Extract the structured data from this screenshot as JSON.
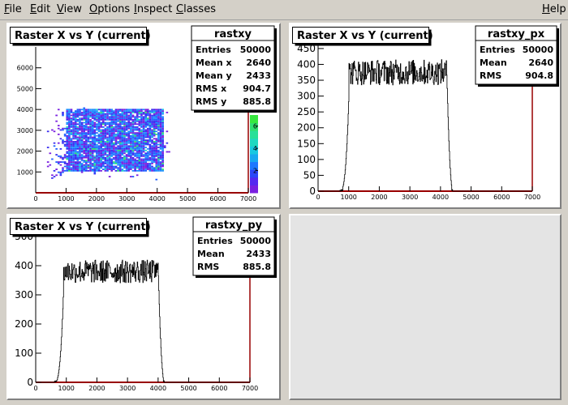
{
  "menu": {
    "file": {
      "ul": "F",
      "rest": "ile"
    },
    "edit": {
      "ul": "E",
      "rest": "dit"
    },
    "view": {
      "ul": "V",
      "rest": "iew"
    },
    "options": {
      "ul": "O",
      "rest": "ptions"
    },
    "inspect": {
      "ul": "I",
      "rest": "nspect"
    },
    "classes": {
      "ul": "C",
      "rest": "lasses"
    },
    "help": {
      "ul": "H",
      "rest": "elp"
    }
  },
  "colors": {
    "axis": "#000000",
    "frame_red": "#990000",
    "stats_fill": "#ffffff"
  },
  "chart_data": [
    {
      "type": "heatmap",
      "title": "Raster X vs Y (current)",
      "xlim": [
        0,
        7000
      ],
      "ylim": [
        0,
        7000
      ],
      "x_ticks": [
        0,
        1000,
        2000,
        3000,
        4000,
        5000,
        6000,
        7000
      ],
      "y_ticks": [
        1000,
        2000,
        3000,
        4000,
        5000,
        6000
      ],
      "z_ticks": [
        2,
        4,
        6
      ],
      "zlim": [
        0,
        7
      ],
      "region": {
        "x": [
          1000,
          4200
        ],
        "y": [
          1000,
          4000
        ]
      },
      "stats": {
        "name": "rastxy",
        "rows": [
          {
            "label": "Entries",
            "value": "50000"
          },
          {
            "label": "Mean x",
            "value": "2640"
          },
          {
            "label": "Mean y",
            "value": "2433"
          },
          {
            "label": "RMS x",
            "value": "904.7"
          },
          {
            "label": "RMS y",
            "value": "885.8"
          }
        ]
      }
    },
    {
      "type": "line",
      "title": "Raster X vs Y (current)",
      "xlim": [
        0,
        7000
      ],
      "ylim": [
        0,
        460
      ],
      "x_ticks": [
        0,
        1000,
        2000,
        3000,
        4000,
        5000,
        6000,
        7000
      ],
      "y_ticks": [
        0,
        50,
        100,
        150,
        200,
        250,
        300,
        350,
        400,
        450
      ],
      "plateau": {
        "start": 1000,
        "end": 4200,
        "level": 375
      },
      "stats": {
        "name": "rastxy_px",
        "rows": [
          {
            "label": "Entries",
            "value": "50000"
          },
          {
            "label": "Mean",
            "value": "2640"
          },
          {
            "label": "RMS",
            "value": "904.8"
          }
        ]
      }
    },
    {
      "type": "line",
      "title": "Raster X vs Y (current)",
      "xlim": [
        0,
        7000
      ],
      "ylim": [
        0,
        500
      ],
      "x_ticks": [
        0,
        1000,
        2000,
        3000,
        4000,
        5000,
        6000,
        7000
      ],
      "y_ticks": [
        0,
        100,
        200,
        300,
        400,
        500
      ],
      "plateau": {
        "start": 900,
        "end": 4000,
        "level": 380
      },
      "stats": {
        "name": "rastxy_py",
        "rows": [
          {
            "label": "Entries",
            "value": "50000"
          },
          {
            "label": "Mean",
            "value": "2433"
          },
          {
            "label": "RMS",
            "value": "885.8"
          }
        ]
      }
    }
  ]
}
